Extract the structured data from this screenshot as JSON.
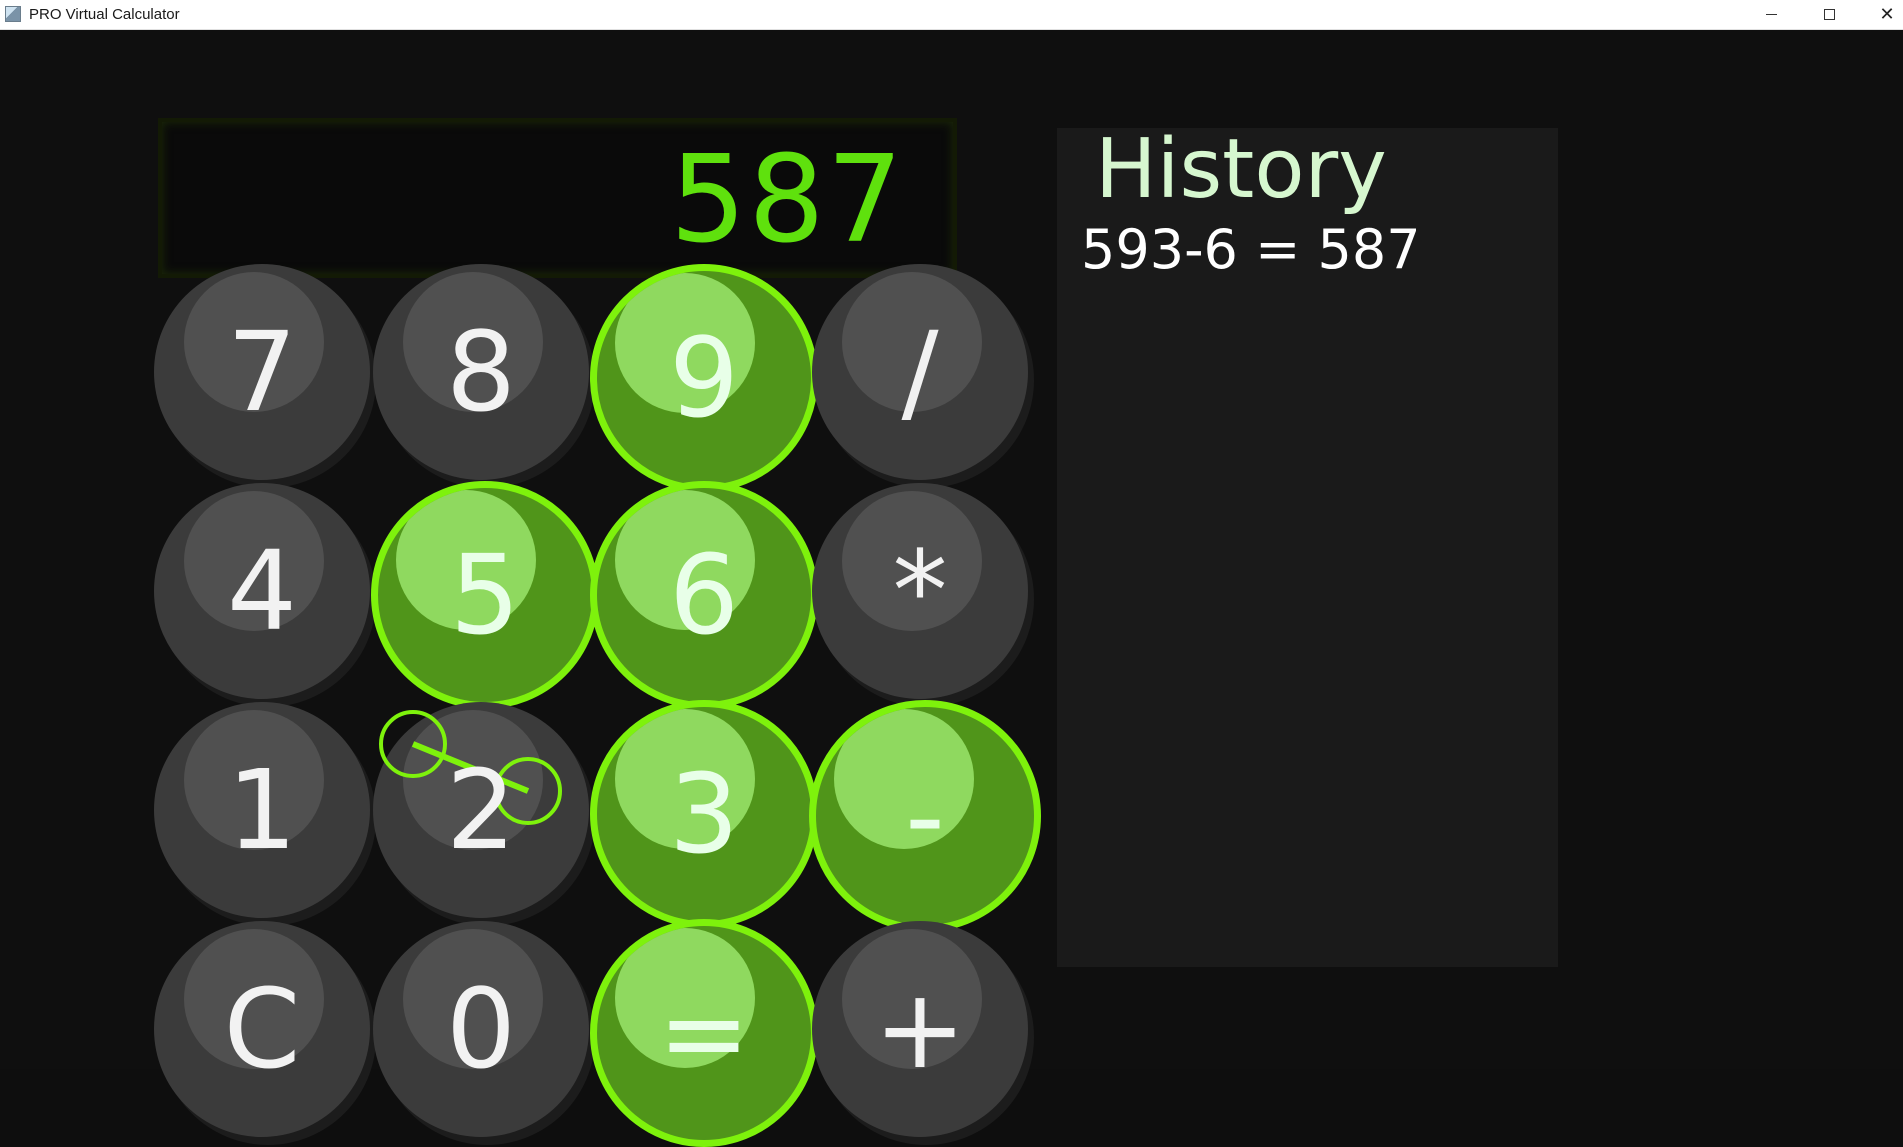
{
  "window": {
    "title": "PRO Virtual Calculator",
    "icon": "calculator-app-icon",
    "controls": {
      "minimize": "minimize-icon",
      "maximize": "maximize-icon",
      "close": "✕"
    }
  },
  "display": {
    "value": "587"
  },
  "history": {
    "title": "History",
    "entries": [
      "593-6 = 587"
    ]
  },
  "keypad": {
    "rows": [
      [
        {
          "label": "7",
          "state": "normal"
        },
        {
          "label": "8",
          "state": "normal"
        },
        {
          "label": "9",
          "state": "active"
        },
        {
          "label": "/",
          "state": "normal"
        }
      ],
      [
        {
          "label": "4",
          "state": "normal"
        },
        {
          "label": "5",
          "state": "active"
        },
        {
          "label": "6",
          "state": "active"
        },
        {
          "label": "*",
          "state": "normal"
        }
      ],
      [
        {
          "label": "1",
          "state": "normal"
        },
        {
          "label": "2",
          "state": "normal"
        },
        {
          "label": "3",
          "state": "active"
        },
        {
          "label": "-",
          "state": "active"
        }
      ],
      [
        {
          "label": "C",
          "state": "normal"
        },
        {
          "label": "0",
          "state": "normal"
        },
        {
          "label": "=",
          "state": "active"
        },
        {
          "label": "+",
          "state": "normal"
        }
      ]
    ]
  },
  "colors": {
    "accent": "#7ef20c",
    "display_text": "#5fe10d",
    "active_key": "#50951a",
    "normal_key": "#3b3b3b",
    "history_title": "#d6f7cf"
  },
  "hand_cursor": {
    "description_icon": "pinch-gesture-icon"
  }
}
